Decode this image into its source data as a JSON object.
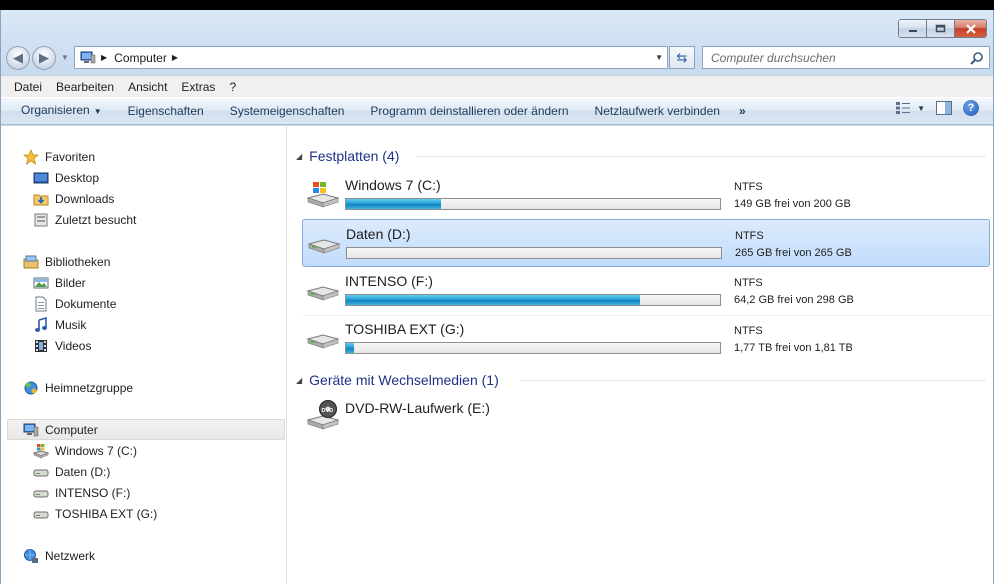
{
  "window": {
    "caption_buttons": [
      "minimize",
      "maximize",
      "close"
    ]
  },
  "address": {
    "crumbs": [
      "Computer"
    ],
    "search_placeholder": "Computer durchsuchen"
  },
  "menubar": {
    "items": [
      "Datei",
      "Bearbeiten",
      "Ansicht",
      "Extras",
      "?"
    ]
  },
  "commandbar": {
    "items": [
      "Organisieren",
      "Eigenschaften",
      "Systemeigenschaften",
      "Programm deinstallieren oder ändern",
      "Netzlaufwerk verbinden"
    ],
    "more": "»"
  },
  "navpane": {
    "favorites": {
      "label": "Favoriten",
      "items": [
        "Desktop",
        "Downloads",
        "Zuletzt besucht"
      ]
    },
    "libraries": {
      "label": "Bibliotheken",
      "items": [
        "Bilder",
        "Dokumente",
        "Musik",
        "Videos"
      ]
    },
    "homegroup": "Heimnetzgruppe",
    "computer": {
      "label": "Computer",
      "items": [
        "Windows 7 (C:)",
        "Daten (D:)",
        "INTENSO (F:)",
        "TOSHIBA EXT (G:)"
      ]
    },
    "network": "Netzwerk"
  },
  "groups": {
    "hdd": {
      "header": "Festplatten (4)",
      "drives": [
        {
          "name": "Windows 7 (C:)",
          "fs": "NTFS",
          "free": "149 GB frei von 200 GB",
          "used_fraction": 0.255,
          "icon": "windows-drive-icon"
        },
        {
          "name": "Daten (D:)",
          "fs": "NTFS",
          "free": "265 GB frei von 265 GB",
          "used_fraction": 0.0,
          "icon": "hard-drive-icon"
        },
        {
          "name": "INTENSO (F:)",
          "fs": "NTFS",
          "free": "64,2 GB frei von 298 GB",
          "used_fraction": 0.785,
          "icon": "hard-drive-icon"
        },
        {
          "name": "TOSHIBA EXT (G:)",
          "fs": "NTFS",
          "free": "1,77 TB frei von 1,81 TB",
          "used_fraction": 0.022,
          "icon": "hard-drive-icon"
        }
      ]
    },
    "removable": {
      "header": "Geräte mit Wechselmedien (1)",
      "drives": [
        {
          "name": "DVD-RW-Laufwerk (E:)"
        }
      ]
    }
  },
  "colors": {
    "accent": "#26a0da",
    "group_header": "#1e3287",
    "selection": "#c1dcfb"
  }
}
